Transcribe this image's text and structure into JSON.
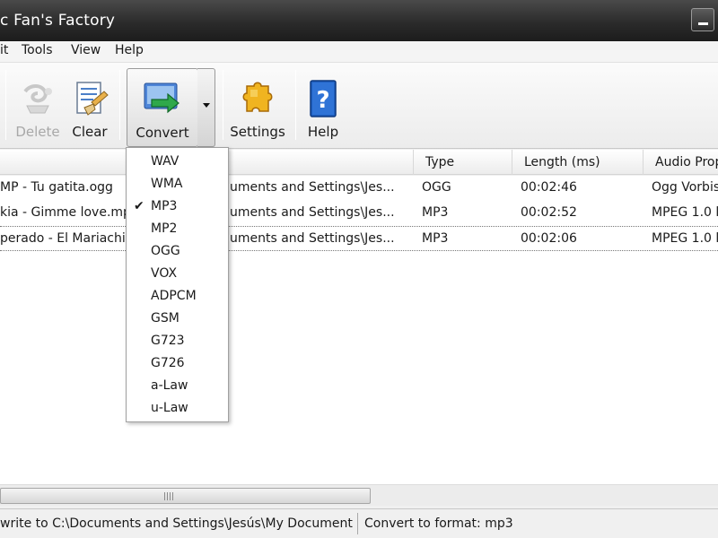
{
  "window": {
    "title": "c Fan's Factory"
  },
  "menu": [
    "it",
    "Tools",
    "View",
    "Help"
  ],
  "toolbar": {
    "delete_label": "Delete",
    "clear_label": "Clear",
    "convert_label": "Convert",
    "settings_label": "Settings",
    "help_label": "Help"
  },
  "list": {
    "columns": [
      "Type",
      "Length (ms)",
      "Audio Prop"
    ],
    "rows": [
      {
        "file": "MP - Tu gatita.ogg",
        "path": "uments and Settings\\Jes...",
        "type": "OGG",
        "length": "00:02:46",
        "audio": "Ogg Vorbis"
      },
      {
        "file": "kia - Gimme love.mp3",
        "path": "uments and Settings\\Jes...",
        "type": "MP3",
        "length": "00:02:52",
        "audio": "MPEG 1.0 l"
      },
      {
        "file": "perado - El Mariachi.",
        "path": "uments and Settings\\Jes...",
        "type": "MP3",
        "length": "00:02:06",
        "audio": "MPEG 1.0 l"
      }
    ]
  },
  "format_menu": {
    "items": [
      "WAV",
      "WMA",
      "MP3",
      "MP2",
      "OGG",
      "VOX",
      "ADPCM",
      "GSM",
      "G723",
      "G726",
      "a-Law",
      "u-Law"
    ],
    "checked": "MP3",
    "check_glyph": "✔"
  },
  "status": {
    "left": " write to C:\\Documents and Settings\\Jesús\\My Document",
    "right": "Convert to format: mp3"
  },
  "colors": {
    "titlebar": "#2b2b2b",
    "convert_green": "#2fa84a",
    "help_blue": "#1f5fbf",
    "settings_gold": "#f0b420"
  }
}
